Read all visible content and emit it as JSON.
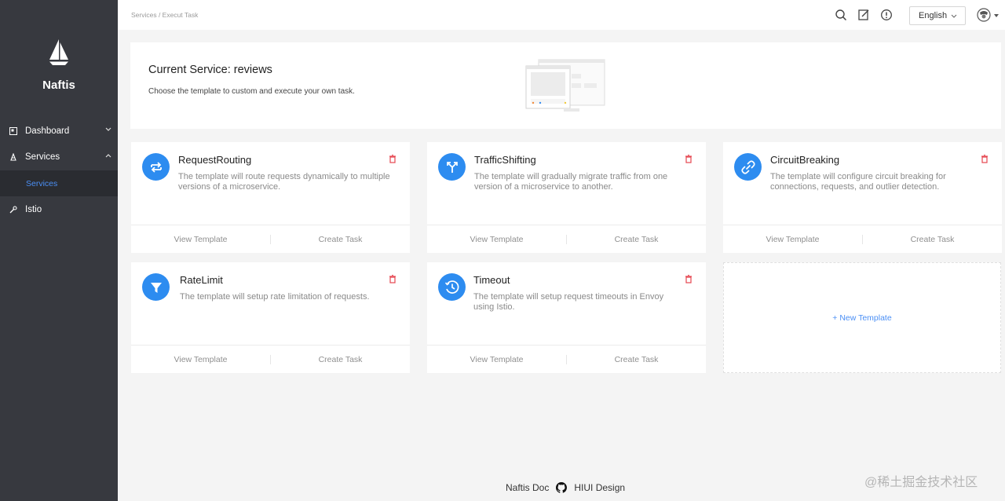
{
  "sidebar": {
    "logo_text": "Naftis",
    "items": [
      {
        "label": "Dashboard",
        "icon": "dashboard-icon",
        "expanded": false
      },
      {
        "label": "Services",
        "icon": "services-icon",
        "expanded": true,
        "children": [
          {
            "label": "Services",
            "active": true
          }
        ]
      },
      {
        "label": "Istio",
        "icon": "istio-icon"
      }
    ]
  },
  "header": {
    "breadcrumb": "Services / Execut Task",
    "icons": [
      "search-icon",
      "edit-icon",
      "info-icon"
    ],
    "language": "English"
  },
  "banner": {
    "title": "Current Service: reviews",
    "description": "Choose the template to custom and execute your own task."
  },
  "cards": [
    {
      "title": "RequestRouting",
      "description": "The template will route requests dynamically to multiple versions of a microservice.",
      "icon": "routing-icon",
      "view_label": "View Template",
      "create_label": "Create Task"
    },
    {
      "title": "TrafficShifting",
      "description": "The template will gradually migrate traffic from one version of a microservice to another.",
      "icon": "shifting-icon",
      "view_label": "View Template",
      "create_label": "Create Task"
    },
    {
      "title": "CircuitBreaking",
      "description": "The template will configure circuit breaking for connections, requests, and outlier detection.",
      "icon": "link-icon",
      "view_label": "View Template",
      "create_label": "Create Task"
    },
    {
      "title": "RateLimit",
      "description": "The template will setup rate limitation of requests.",
      "icon": "filter-icon",
      "view_label": "View Template",
      "create_label": "Create Task"
    },
    {
      "title": "Timeout",
      "description": "The template will setup request timeouts in Envoy using Istio.",
      "icon": "clock-icon",
      "view_label": "View Template",
      "create_label": "Create Task"
    }
  ],
  "new_template_label": "+ New Template",
  "footer": {
    "doc_link": "Naftis Doc",
    "design_link": "HIUI Design"
  },
  "watermark": "@稀土掘金技术社区",
  "colors": {
    "sidebar": "#37393f",
    "accent": "#2d8cf0",
    "delete": "#e5454f"
  }
}
